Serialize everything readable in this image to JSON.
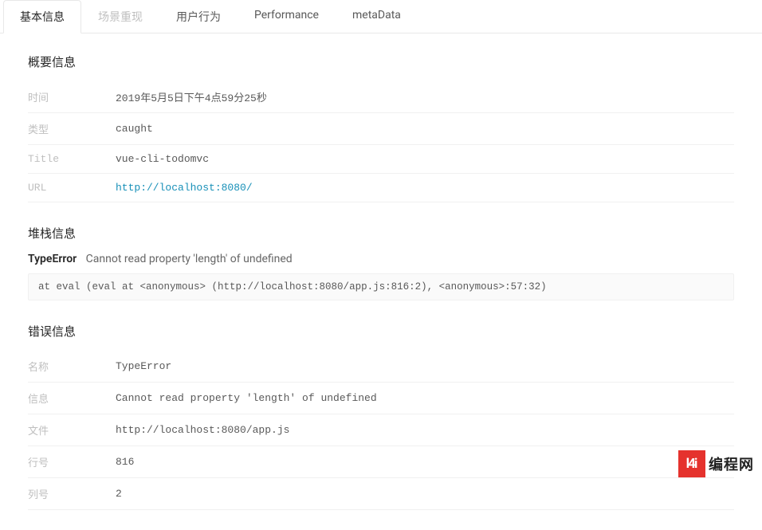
{
  "tabs": {
    "basic_info": "基本信息",
    "scene_replay": "场景重现",
    "user_behavior": "用户行为",
    "performance": "Performance",
    "metadata": "metaData"
  },
  "summary": {
    "title": "概要信息",
    "time_label": "时间",
    "time_value": "2019年5月5日下午4点59分25秒",
    "type_label": "类型",
    "type_value": "caught",
    "title_label": "Title",
    "title_value": "vue-cli-todomvc",
    "url_label": "URL",
    "url_value": "http://localhost:8080/"
  },
  "stack": {
    "title": "堆栈信息",
    "error_type": "TypeError",
    "error_message": "Cannot read property 'length' of undefined",
    "trace": "at eval (eval at <anonymous> (http://localhost:8080/app.js:816:2), <anonymous>:57:32)"
  },
  "error": {
    "title": "错误信息",
    "name_label": "名称",
    "name_value": "TypeError",
    "msg_label": "信息",
    "msg_value": "Cannot read property 'length' of undefined",
    "file_label": "文件",
    "file_value": "http://localhost:8080/app.js",
    "line_label": "行号",
    "line_value": "816",
    "col_label": "列号",
    "col_value": "2"
  },
  "watermark": {
    "block": "l4i",
    "text": "编程网"
  }
}
